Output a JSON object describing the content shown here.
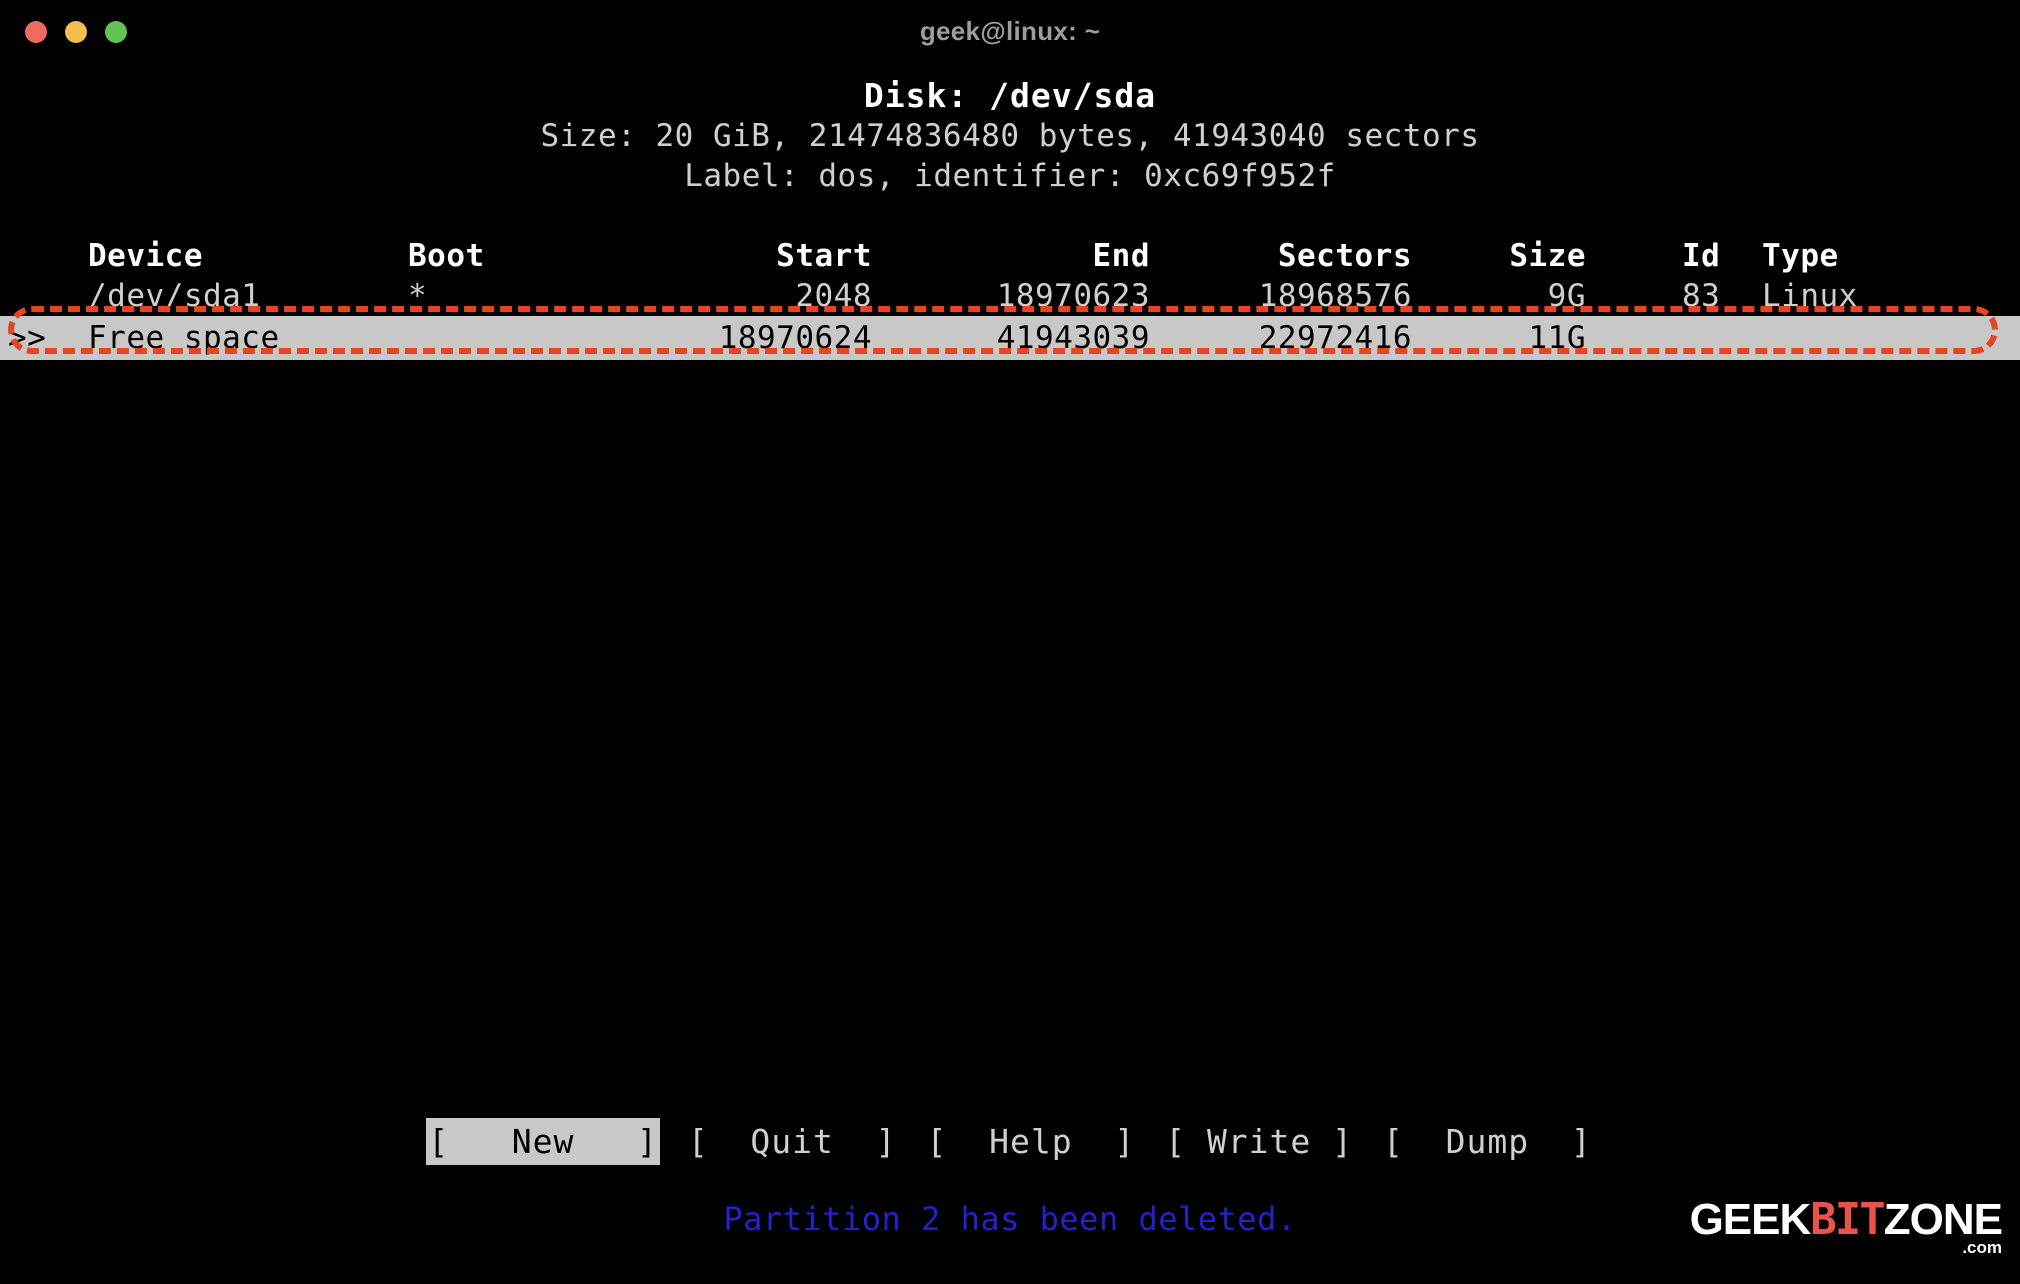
{
  "window": {
    "title": "geek@linux: ~",
    "traffic_lights": [
      {
        "name": "close",
        "color": "#ec6a5e"
      },
      {
        "name": "minimize",
        "color": "#f4bf4f"
      },
      {
        "name": "zoom",
        "color": "#61c454"
      }
    ]
  },
  "disk": {
    "title": "Disk: /dev/sda",
    "size_line": "Size: 20 GiB, 21474836480 bytes, 41943040 sectors",
    "label_line": "Label: dos, identifier: 0xc69f952f"
  },
  "table": {
    "headers": {
      "marker": "",
      "device": "Device",
      "boot": "Boot",
      "start": "Start",
      "end": "End",
      "sectors": "Sectors",
      "size": "Size",
      "id": "Id",
      "type": "Type"
    },
    "rows": [
      {
        "marker": "",
        "device": "/dev/sda1",
        "boot": "*",
        "start": "2048",
        "end": "18970623",
        "sectors": "18968576",
        "size": "9G",
        "id": "83",
        "type": "Linux",
        "selected": false
      },
      {
        "marker": ">>",
        "device": "Free space",
        "boot": "",
        "start": "18970624",
        "end": "41943039",
        "sectors": "22972416",
        "size": "11G",
        "id": "",
        "type": "",
        "selected": true
      }
    ]
  },
  "annotation": {
    "color": "#e8441f",
    "style": "dashed-rounded-rectangle",
    "targets": "free-space-row"
  },
  "menu": {
    "buttons": [
      {
        "label": "[   New   ]",
        "name": "new",
        "active": true
      },
      {
        "label": "[  Quit  ]",
        "name": "quit",
        "active": false
      },
      {
        "label": "[  Help  ]",
        "name": "help",
        "active": false
      },
      {
        "label": "[ Write ]",
        "name": "write",
        "active": false
      },
      {
        "label": "[  Dump  ]",
        "name": "dump",
        "active": false
      }
    ]
  },
  "status": {
    "message": "Partition 2 has been deleted.",
    "color": "#2222cc"
  },
  "watermark": {
    "part1": "GEEK",
    "part2": "BIT",
    "part3": "ZONE",
    "suffix": ".com"
  }
}
